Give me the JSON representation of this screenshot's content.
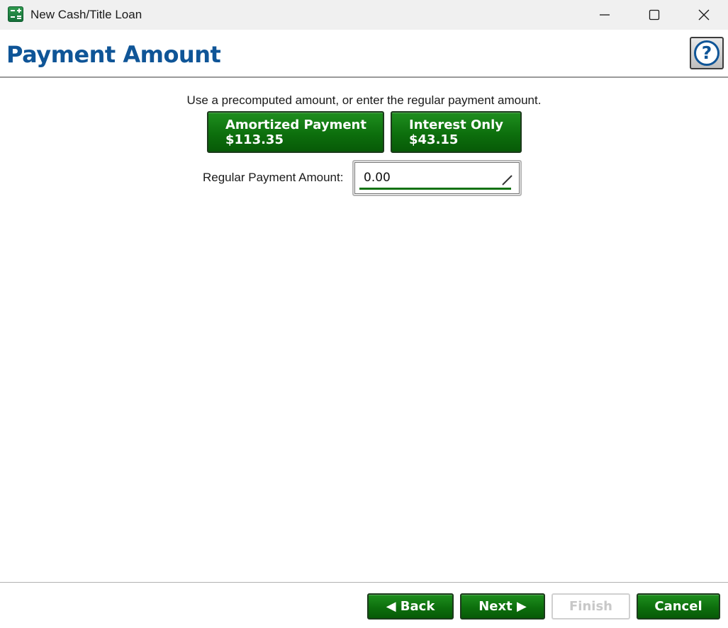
{
  "window": {
    "title": "New Cash/Title Loan",
    "app_icon": "calculator-icon",
    "controls": [
      "minimize-icon",
      "maximize-icon",
      "close-icon"
    ]
  },
  "header": {
    "title": "Payment Amount",
    "help_label": "?",
    "title_color": "#0f5597"
  },
  "main": {
    "instruction": "Use a precomputed amount, or enter the regular payment amount.",
    "presets": [
      {
        "label": "Amortized Payment",
        "amount": "$113.35"
      },
      {
        "label": "Interest Only",
        "amount": "$43.15"
      }
    ],
    "payment_field": {
      "label": "Regular Payment Amount:",
      "value": "0.00"
    }
  },
  "footer": {
    "back_label": "◀ Back",
    "next_label": "Next ▶",
    "finish_label": "Finish",
    "cancel_label": "Cancel",
    "finish_enabled": false
  },
  "colors": {
    "accent_green": "#0d6f0d",
    "title_blue": "#0f5597"
  }
}
